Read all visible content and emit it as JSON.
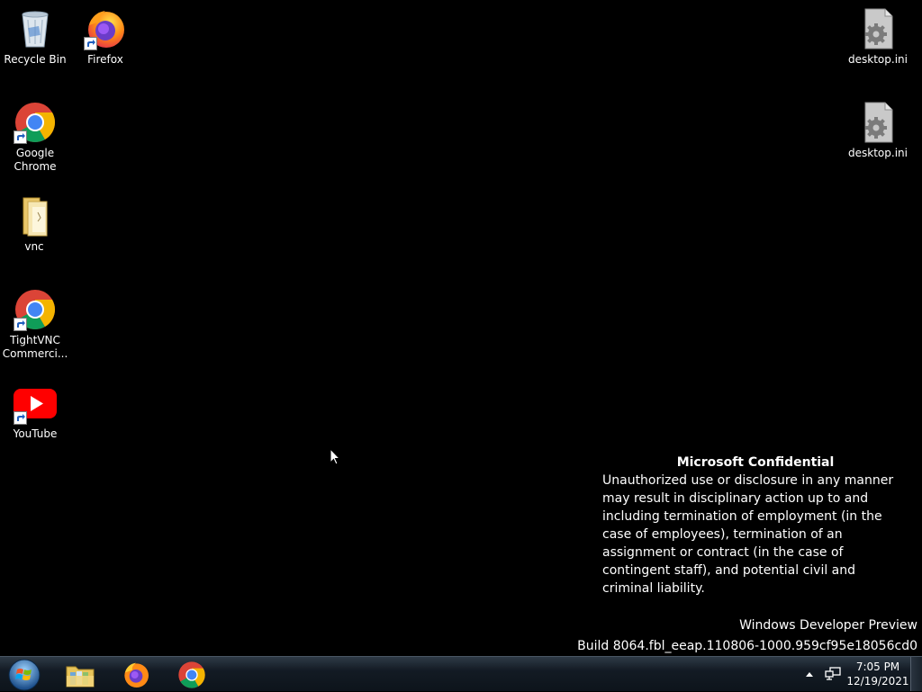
{
  "desktop": {
    "icons": [
      {
        "label": "Recycle Bin",
        "icon": "recycle-bin-icon"
      },
      {
        "label": "Firefox",
        "icon": "firefox-icon"
      },
      {
        "label": "Google Chrome",
        "icon": "chrome-icon"
      },
      {
        "label": "vnc",
        "icon": "folder-icon"
      },
      {
        "label": "TightVNC Commerci...",
        "icon": "chrome-icon"
      },
      {
        "label": "YouTube",
        "icon": "youtube-icon"
      },
      {
        "label": "desktop.ini",
        "icon": "settings-file-icon"
      },
      {
        "label": "desktop.ini",
        "icon": "settings-file-icon"
      }
    ]
  },
  "watermark": {
    "title": "Microsoft Confidential",
    "body": "Unauthorized use or disclosure in any manner may result in disciplinary action up to and including termination of employment (in the case of employees), termination of an assignment or contract (in the case of contingent staff), and potential civil and criminal liability.",
    "product": "Windows Developer Preview",
    "build": "Build 8064.fbl_eeap.110806-1000.959cf95e18056cd0"
  },
  "taskbar": {
    "pinned": [
      {
        "name": "file-explorer",
        "icon": "folder-library-icon"
      },
      {
        "name": "firefox",
        "icon": "firefox-icon"
      },
      {
        "name": "chrome",
        "icon": "chrome-icon"
      }
    ],
    "clock": {
      "time": "7:05 PM",
      "date": "12/19/2021"
    }
  },
  "colors": {
    "desktop_bg": "#000000",
    "taskbar_bg": "#131b24",
    "text": "#ffffff"
  }
}
